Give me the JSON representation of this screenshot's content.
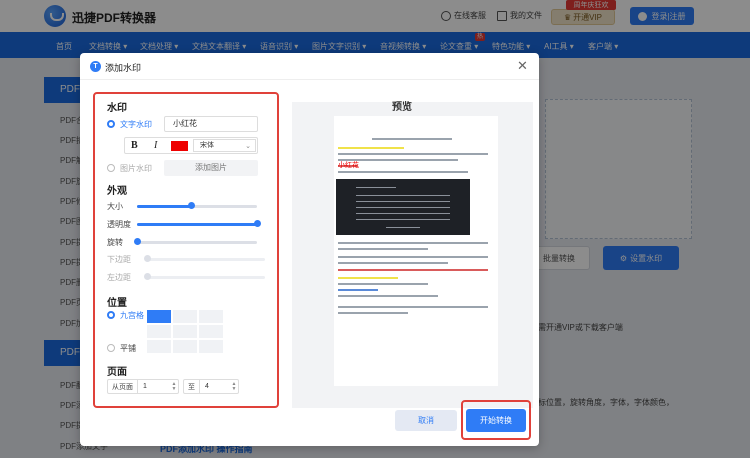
{
  "header": {
    "brand": "迅捷PDF转换器",
    "support": "在线客服",
    "my_files": "我的文件",
    "vip_badge": "周年庆狂欢",
    "vip_button": "开通VIP",
    "login": "登录|注册"
  },
  "nav": {
    "items": [
      {
        "label": "首页"
      },
      {
        "label": "文档转换 ▾"
      },
      {
        "label": "文档处理 ▾"
      },
      {
        "label": "文档文本翻译 ▾"
      },
      {
        "label": "语音识别 ▾"
      },
      {
        "label": "图片文字识别 ▾"
      },
      {
        "label": "音视频转换 ▾"
      },
      {
        "label": "论文查重 ▾"
      },
      {
        "label": "特色功能 ▾"
      },
      {
        "label": "AI工具 ▾"
      },
      {
        "label": "客户端 ▾"
      }
    ],
    "hot_badge": "热"
  },
  "sidebar": {
    "head1": "PDF",
    "items1": [
      "PDF合",
      "PDF拆",
      "PDF解",
      "PDF旋",
      "PDF修",
      "PDF图",
      "PDF提",
      "PDF提",
      "PDF删",
      "PDF页",
      "PDF加",
      "PDF文"
    ],
    "head2": "PDF",
    "items2": [
      "PDF翻",
      "PDF添",
      "PDF提",
      "PDF添加文字"
    ]
  },
  "background": {
    "batch_convert": "批量转换",
    "set_watermark": "设置水印",
    "note1": "需开通VIP或下载客户端",
    "note2": "标位置，旋转角度，字体，字体颜色，",
    "help_title": "PDF添加水印 操作指南"
  },
  "dialog": {
    "title": "添加水印",
    "close": "✕",
    "watermark_section": "水印",
    "text_watermark": "文字水印",
    "text_value": "小红花",
    "bold": "B",
    "italic": "I",
    "color": "#ee0000",
    "font": "宋体",
    "image_watermark": "图片水印",
    "add_image": "添加图片",
    "appearance_section": "外观",
    "size_label": "大小",
    "size_value": 0.45,
    "opacity_label": "透明度",
    "opacity_value": 1.0,
    "rotate_label": "旋转",
    "rotate_value": 0.0,
    "bottom_margin_label": "下边距",
    "left_margin_label": "左边距",
    "position_section": "位置",
    "nine_grid": "九宫格",
    "tile": "平铺",
    "pages_section": "页面",
    "from_page_label": "从页面",
    "from_page": "1",
    "to_label": "至",
    "to_page": "4",
    "preview_title": "预览",
    "preview_watermark": "小红花",
    "cancel": "取消",
    "start": "开始转换"
  }
}
